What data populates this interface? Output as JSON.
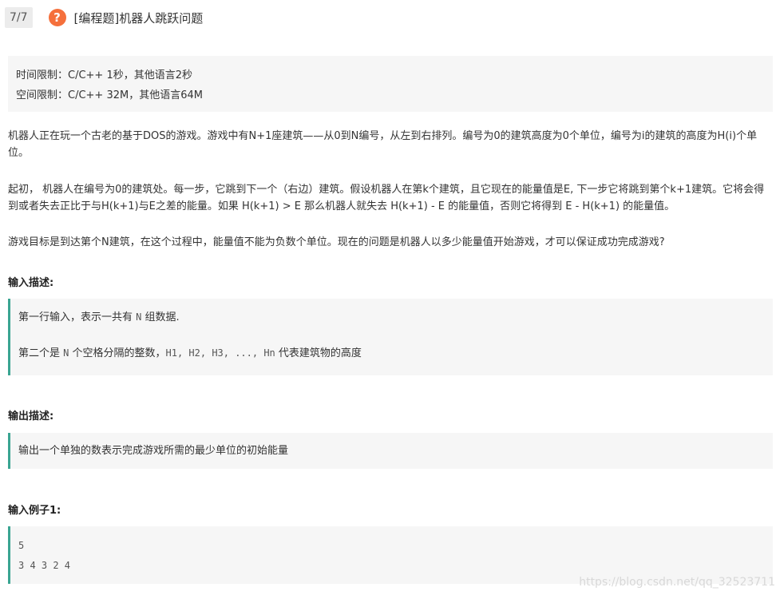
{
  "header": {
    "progress": "7/7",
    "question_icon": "question-icon",
    "title": "[编程题]机器人跳跃问题"
  },
  "limits": {
    "time": "时间限制：C/C++ 1秒，其他语言2秒",
    "space": "空间限制：C/C++ 32M，其他语言64M"
  },
  "description": {
    "p1": "机器人正在玩一个古老的基于DOS的游戏。游戏中有N+1座建筑——从0到N编号，从左到右排列。编号为0的建筑高度为0个单位，编号为i的建筑的高度为H(i)个单位。",
    "p2": "起初， 机器人在编号为0的建筑处。每一步，它跳到下一个（右边）建筑。假设机器人在第k个建筑，且它现在的能量值是E, 下一步它将跳到第个k+1建筑。它将会得到或者失去正比于与H(k+1)与E之差的能量。如果 H(k+1) > E 那么机器人就失去 H(k+1) - E 的能量值，否则它将得到 E - H(k+1) 的能量值。",
    "p3": "游戏目标是到达第个N建筑，在这个过程中，能量值不能为负数个单位。现在的问题是机器人以多少能量值开始游戏，才可以保证成功完成游戏?"
  },
  "input_desc": {
    "title": "输入描述:",
    "line1_a": "第一行输入，表示一共有 ",
    "line1_code": "N",
    "line1_b": " 组数据.",
    "line2_a": "第二个是 ",
    "line2_code": "N",
    "line2_b": " 个空格分隔的整数，",
    "line2_code2": "H1, H2, H3, ..., Hn",
    "line2_c": " 代表建筑物的高度"
  },
  "output_desc": {
    "title": "输出描述:",
    "text": "输出一个单独的数表示完成游戏所需的最少单位的初始能量"
  },
  "example": {
    "title": "输入例子1:",
    "line1": "5",
    "line2": "3 4 3 2 4"
  },
  "watermark": "https://blog.csdn.net/qq_32523711"
}
